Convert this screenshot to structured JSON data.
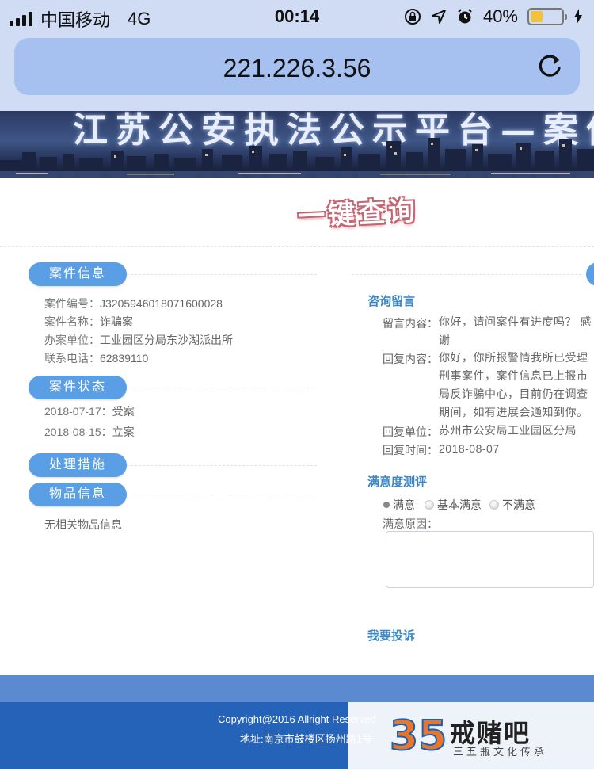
{
  "status_bar": {
    "carrier": "中国移动",
    "network": "4G",
    "time": "00:14",
    "battery": "40%",
    "battery_level": 0.4
  },
  "browser": {
    "url": "221.226.3.56"
  },
  "banner": {
    "title": "江苏公安执法公示平台—案件办理公"
  },
  "query_title": "一键查询",
  "case_info": {
    "pill": "案件信息",
    "rows": [
      {
        "label": "案件编号：",
        "value": "J3205946018071600028"
      },
      {
        "label": "案件名称：",
        "value": "诈骗案"
      },
      {
        "label": "办案单位：",
        "value": "工业园区分局东沙湖派出所"
      },
      {
        "label": "联系电话：",
        "value": "62839110"
      }
    ]
  },
  "case_status": {
    "pill": "案件状态",
    "rows": [
      {
        "label": "2018-07-17：",
        "value": "受案"
      },
      {
        "label": "2018-08-15：",
        "value": "立案"
      }
    ]
  },
  "measures": {
    "pill": "处理措施"
  },
  "items": {
    "pill": "物品信息",
    "text": "无相关物品信息"
  },
  "consult": {
    "title": "咨询留言",
    "message_label": "留言内容：",
    "message": "你好，请问案件有进度吗？ 感谢",
    "reply_label": "回复内容：",
    "reply": "你好，你所报警情我所已受理刑事案件，案件信息已上报市局反诈骗中心，目前仍在调查期间，如有进展会通知到你。",
    "unit_label": "回复单位：",
    "unit": "苏州市公安局工业园区分局",
    "time_label": "回复时间：",
    "time": "2018-08-07"
  },
  "rating": {
    "title": "满意度测评",
    "options": [
      "满意",
      "基本满意",
      "不满意"
    ],
    "reason_label": "满意原因：",
    "complain": "我要投诉"
  },
  "footer": {
    "copyright": "Copyright@2016 Allright Reserved",
    "address": "地址:南京市鼓楼区扬州路1号"
  },
  "watermark": {
    "logo_digits": "35",
    "name": "戒赌吧",
    "slogan": "三五瓶文化传承"
  },
  "colors": {
    "pill_blue": "#5a9ee6",
    "section_blue": "#3a86c7",
    "footer_blue": "#2563b9"
  }
}
